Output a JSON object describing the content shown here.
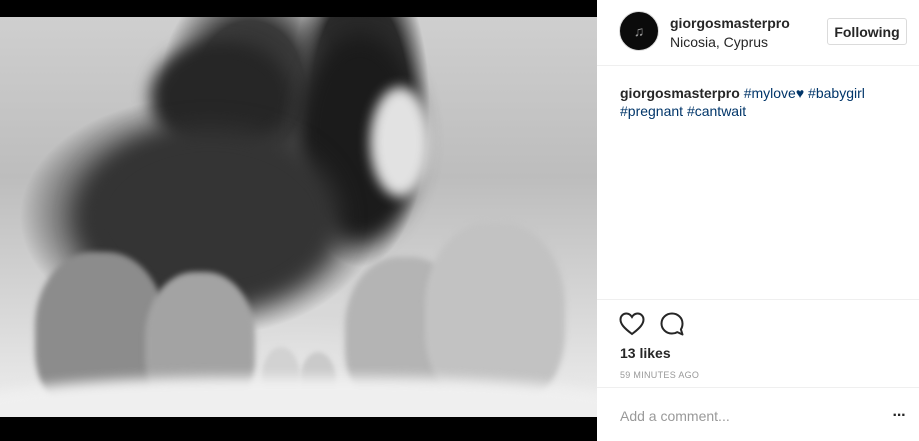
{
  "post": {
    "image_alt": "Black and white photo of parents' and baby's feet on a bed",
    "username": "giorgosmasterpro",
    "location": "Nicosia, Cyprus",
    "follow_label": "Following",
    "caption": {
      "username": "giorgosmasterpro",
      "tags": [
        "#mylove",
        "#babygirl",
        "#pregnant",
        "#cantwait"
      ],
      "emoji": "♥"
    },
    "likes": "13 likes",
    "time_ago": "59 MINUTES AGO",
    "comment_placeholder": "Add a comment...",
    "more_label": "···"
  },
  "colors": {
    "hashtag": "#003569",
    "text": "#262626",
    "muted": "#999999",
    "border": "#efefef"
  }
}
